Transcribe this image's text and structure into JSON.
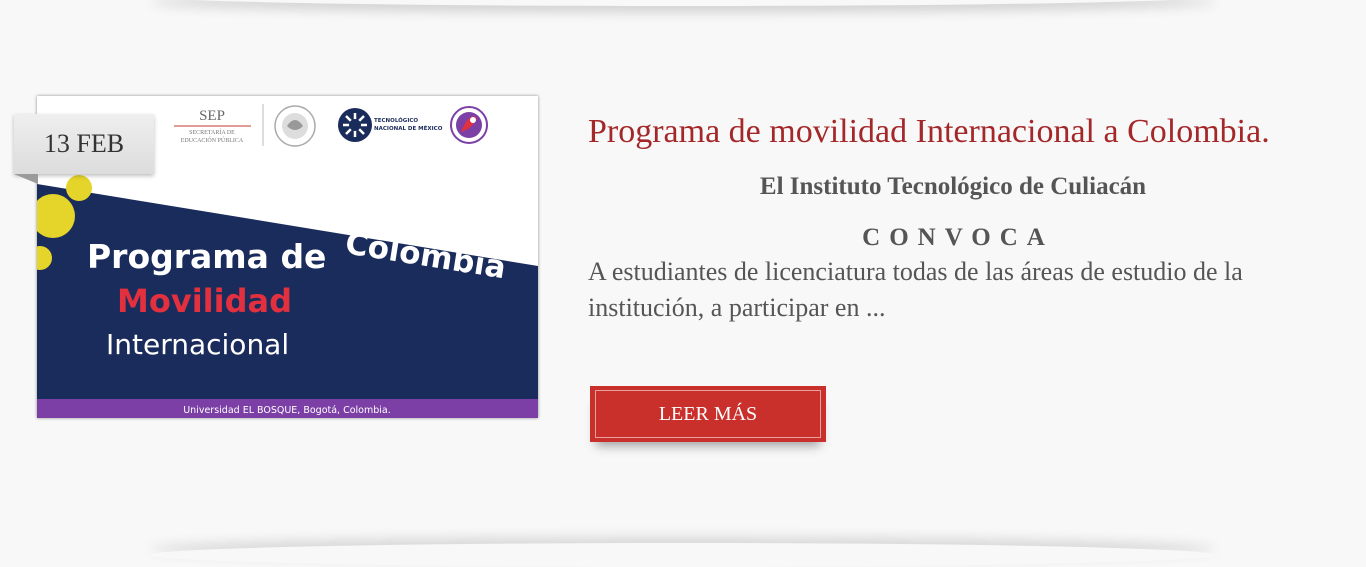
{
  "post": {
    "date": "13 FEB",
    "image": {
      "logo_sep": "SEP",
      "logo_sep_sub1": "SECRETARÍA DE",
      "logo_sep_sub2": "EDUCACIÓN PÚBLICA",
      "logo_tecnm_1": "TECNOLÓGICO",
      "logo_tecnm_2": "NACIONAL DE MÉXICO",
      "line1": "Programa de",
      "line2": "Movilidad",
      "line3": "Internacional",
      "country": "Colombia",
      "footer": "Universidad EL BOSQUE, Bogotá, Colombia.",
      "colors": {
        "navy": "#1a2c5b",
        "red": "#e3303f",
        "purple": "#7b3fa6",
        "yellow": "#e5d42a"
      }
    },
    "title": "Programa de movilidad Internacional a Colombia.",
    "subtitle": "El Instituto Tecnológico de Culiacán",
    "convoca": "CONVOCA",
    "description": "A estudiantes de licenciatura todas de las áreas de estudio de la institución, a participar en ...",
    "button_label": "LEER MÁS",
    "accent_color": "#a4282a",
    "button_color": "#c9302c"
  }
}
